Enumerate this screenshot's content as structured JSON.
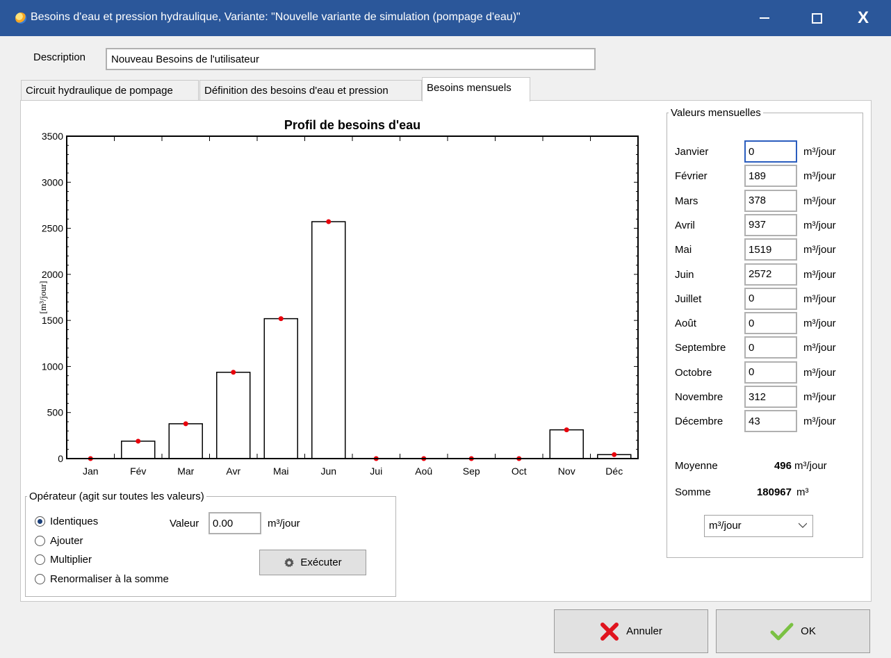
{
  "window": {
    "title": "Besoins d'eau et pression hydraulique, Variante:   \"Nouvelle variante de simulation (pompage d'eau)\"",
    "minimize": "—",
    "close": "X"
  },
  "description": {
    "label": "Description",
    "value": "Nouveau Besoins de l'utilisateur"
  },
  "tabs": [
    "Circuit hydraulique de pompage",
    "Définition des besoins d'eau et pression",
    "Besoins mensuels"
  ],
  "chart_data": {
    "type": "bar",
    "title": "Profil de besoins d'eau",
    "ylabel": "[m³/jour]",
    "xlabel": "",
    "categories": [
      "Jan",
      "Fév",
      "Mar",
      "Avr",
      "Mai",
      "Jun",
      "Jui",
      "Aoû",
      "Sep",
      "Oct",
      "Nov",
      "Déc"
    ],
    "values": [
      0,
      189,
      378,
      937,
      1519,
      2572,
      0,
      0,
      0,
      0,
      312,
      43
    ],
    "ylim": [
      0,
      3500
    ],
    "yticks": [
      0,
      500,
      1000,
      1500,
      2000,
      2500,
      3000,
      3500
    ],
    "marker_color": "#e8000b",
    "bar_fill": "#ffffff",
    "bar_stroke": "#000000"
  },
  "operator": {
    "legend": "Opérateur (agit sur toutes les valeurs)",
    "options": [
      "Identiques",
      "Ajouter",
      "Multiplier",
      "Renormaliser à la somme"
    ],
    "selected": "Identiques",
    "value_label": "Valeur",
    "value": "0.00",
    "unit": "m³/jour",
    "execute": "Exécuter"
  },
  "monthly": {
    "legend": "Valeurs mensuelles",
    "unit": "m³/jour",
    "months": [
      {
        "label": "Janvier",
        "value": "0"
      },
      {
        "label": "Février",
        "value": "189"
      },
      {
        "label": "Mars",
        "value": "378"
      },
      {
        "label": "Avril",
        "value": "937"
      },
      {
        "label": "Mai",
        "value": "1519"
      },
      {
        "label": "Juin",
        "value": "2572"
      },
      {
        "label": "Juillet",
        "value": "0"
      },
      {
        "label": "Août",
        "value": "0"
      },
      {
        "label": "Septembre",
        "value": "0"
      },
      {
        "label": "Octobre",
        "value": "0"
      },
      {
        "label": "Novembre",
        "value": "312"
      },
      {
        "label": "Décembre",
        "value": "43"
      }
    ],
    "average_label": "Moyenne",
    "average_value": "496",
    "average_unit": "m³/jour",
    "sum_label": "Somme",
    "sum_value": "180967",
    "sum_unit": "m³",
    "unit_select": "m³/jour"
  },
  "buttons": {
    "cancel": "Annuler",
    "ok": "OK"
  },
  "colors": {
    "titlebar": "#2b579a",
    "cancel_icon": "#e0141e",
    "ok_icon": "#7ac143"
  }
}
